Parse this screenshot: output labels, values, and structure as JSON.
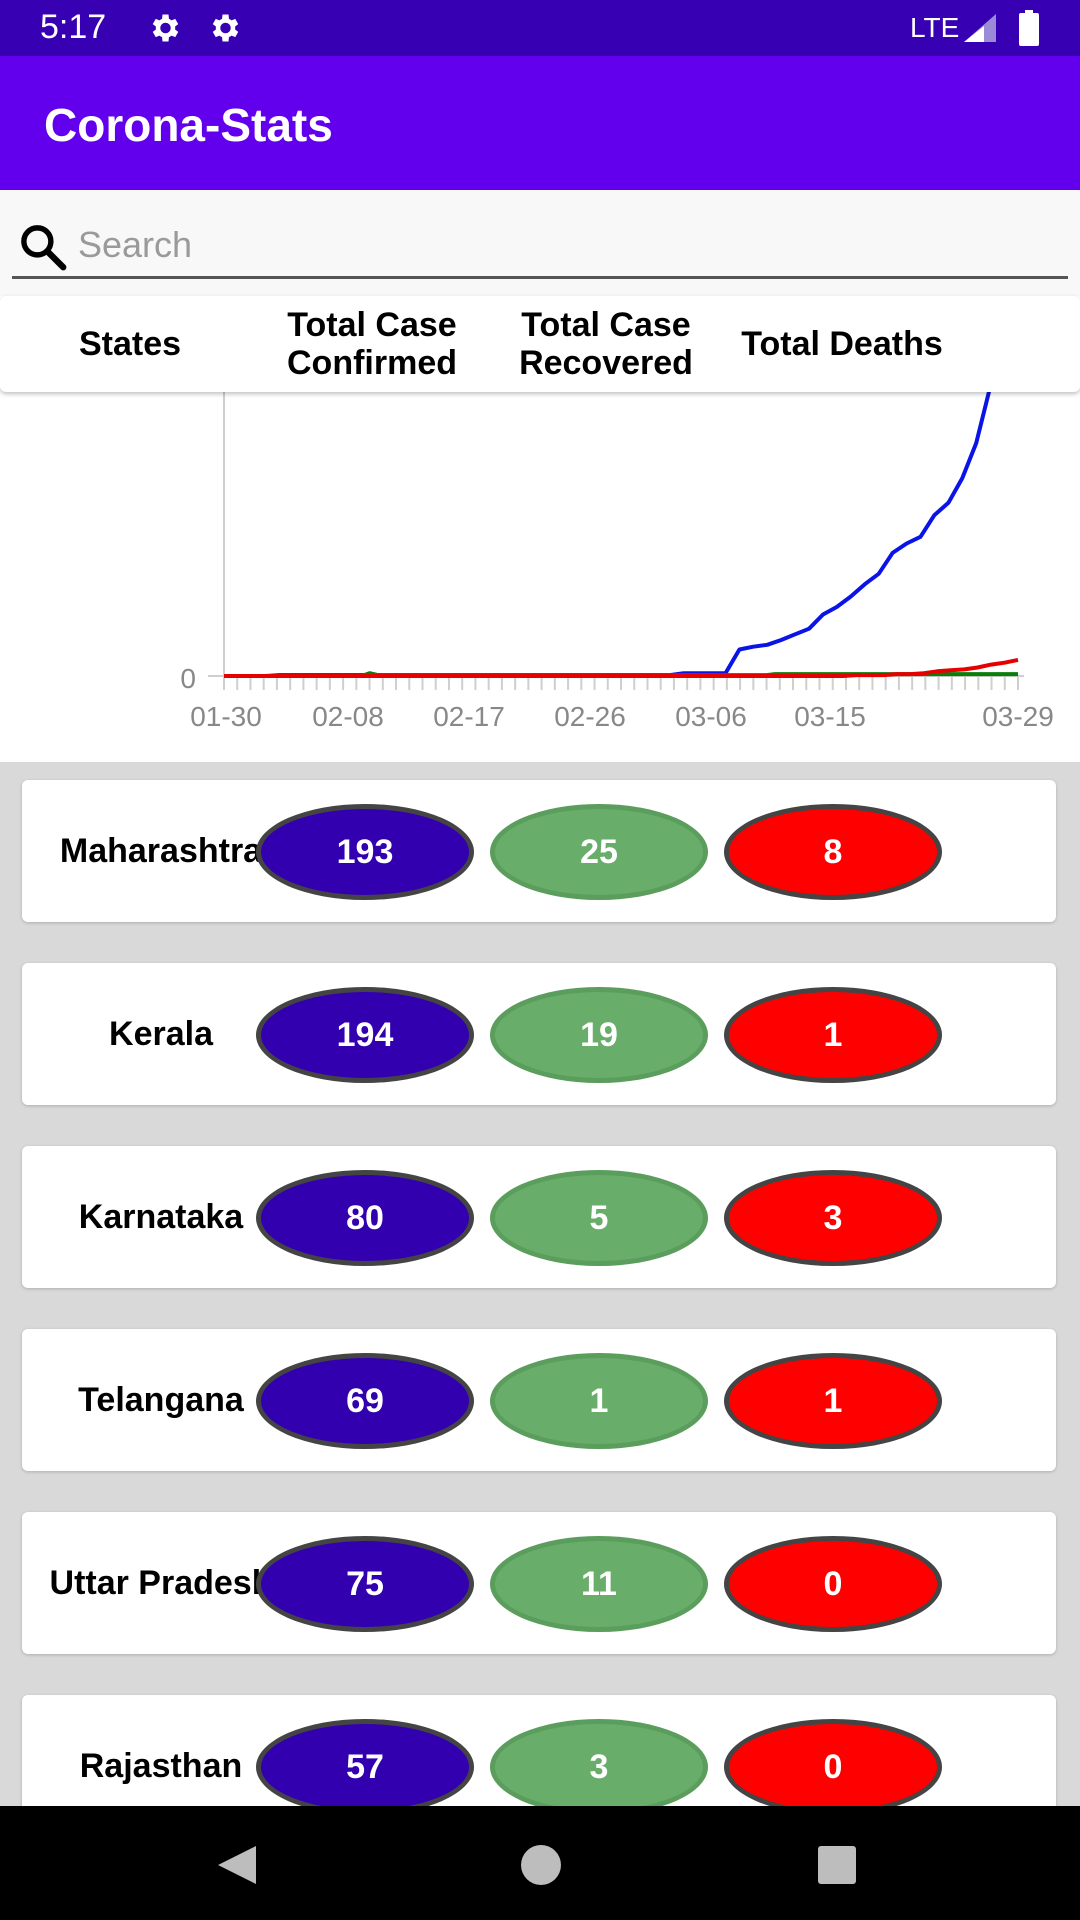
{
  "status_bar": {
    "time": "5:17",
    "network": "LTE",
    "icons": [
      "gear-icon",
      "gear-icon",
      "signal-icon",
      "battery-icon"
    ]
  },
  "app": {
    "title": "Corona-Stats",
    "colors": {
      "primary": "#6200ee",
      "primary_dark": "#3700b3"
    }
  },
  "search": {
    "placeholder": "Search",
    "value": ""
  },
  "table_header": {
    "states": "States",
    "confirmed": "Total Case Confirmed",
    "recovered": "Total Case Recovered",
    "deaths": "Total Deaths"
  },
  "chart_data": {
    "type": "line",
    "x_tick_labels": [
      "01-30",
      "02-08",
      "02-17",
      "02-26",
      "03-06",
      "03-15",
      "03-29"
    ],
    "y_tick_labels": [
      "0"
    ],
    "x_start": "01-30",
    "x_end": "03-29",
    "series": [
      {
        "color": "#0a14e6",
        "values": [
          0,
          0,
          0,
          0,
          1,
          1,
          1,
          1,
          1,
          1,
          1,
          1,
          1,
          1,
          1,
          1,
          1,
          1,
          1,
          1,
          1,
          1,
          1,
          1,
          1,
          1,
          1,
          1,
          1,
          1,
          1,
          1,
          1,
          3,
          3,
          3,
          3,
          28,
          31,
          33,
          38,
          44,
          50,
          65,
          73,
          84,
          97,
          108,
          130,
          140,
          147,
          170,
          183,
          209,
          246,
          305,
          419,
          520
        ]
      },
      {
        "color": "#0a7d0a",
        "values": [
          0,
          0,
          0,
          0,
          0,
          0,
          0,
          0,
          0,
          0,
          0,
          0,
          0,
          0,
          0,
          0,
          0,
          0,
          3,
          1,
          1,
          1,
          1,
          1,
          1,
          1,
          1,
          1,
          1,
          1,
          1,
          1,
          1,
          1,
          1,
          1,
          1,
          1,
          1,
          1,
          1,
          1,
          1,
          1,
          1,
          1,
          1,
          1,
          1,
          1,
          1,
          1,
          1,
          1,
          1,
          1,
          1,
          1,
          1,
          1,
          1,
          1,
          1,
          1,
          1,
          1,
          1,
          1,
          2,
          2,
          2,
          2,
          2,
          2,
          2,
          2,
          2,
          2,
          2,
          2,
          2,
          2,
          2,
          2,
          2,
          2,
          2,
          2,
          2,
          2,
          2,
          2,
          2,
          2,
          2,
          2,
          2,
          2,
          2
        ]
      },
      {
        "color": "#e60000",
        "values": [
          0,
          0,
          0,
          0,
          0,
          0,
          0,
          0,
          0,
          0,
          0,
          0,
          0,
          0,
          0,
          0,
          0,
          0,
          0,
          0,
          0,
          0,
          0,
          0,
          0,
          0,
          0,
          0,
          0,
          0,
          0,
          0,
          0,
          0,
          0,
          0,
          0,
          0,
          0,
          0,
          0,
          0,
          0,
          0,
          0,
          0,
          0,
          1,
          1,
          1,
          2,
          2,
          3,
          5,
          6,
          7,
          9,
          12,
          14,
          17
        ]
      }
    ],
    "grid": false,
    "legend": "none"
  },
  "rows": [
    {
      "state": "Maharashtra",
      "confirmed": "193",
      "recovered": "25",
      "deaths": "8"
    },
    {
      "state": "Kerala",
      "confirmed": "194",
      "recovered": "19",
      "deaths": "1"
    },
    {
      "state": "Karnataka",
      "confirmed": "80",
      "recovered": "5",
      "deaths": "3"
    },
    {
      "state": "Telangana",
      "confirmed": "69",
      "recovered": "1",
      "deaths": "1"
    },
    {
      "state": "Uttar Pradesh",
      "confirmed": "75",
      "recovered": "11",
      "deaths": "0"
    },
    {
      "state": "Rajasthan",
      "confirmed": "57",
      "recovered": "3",
      "deaths": "0"
    }
  ],
  "nav_bar": {
    "icons": [
      "back-icon",
      "home-icon",
      "recents-icon"
    ]
  }
}
